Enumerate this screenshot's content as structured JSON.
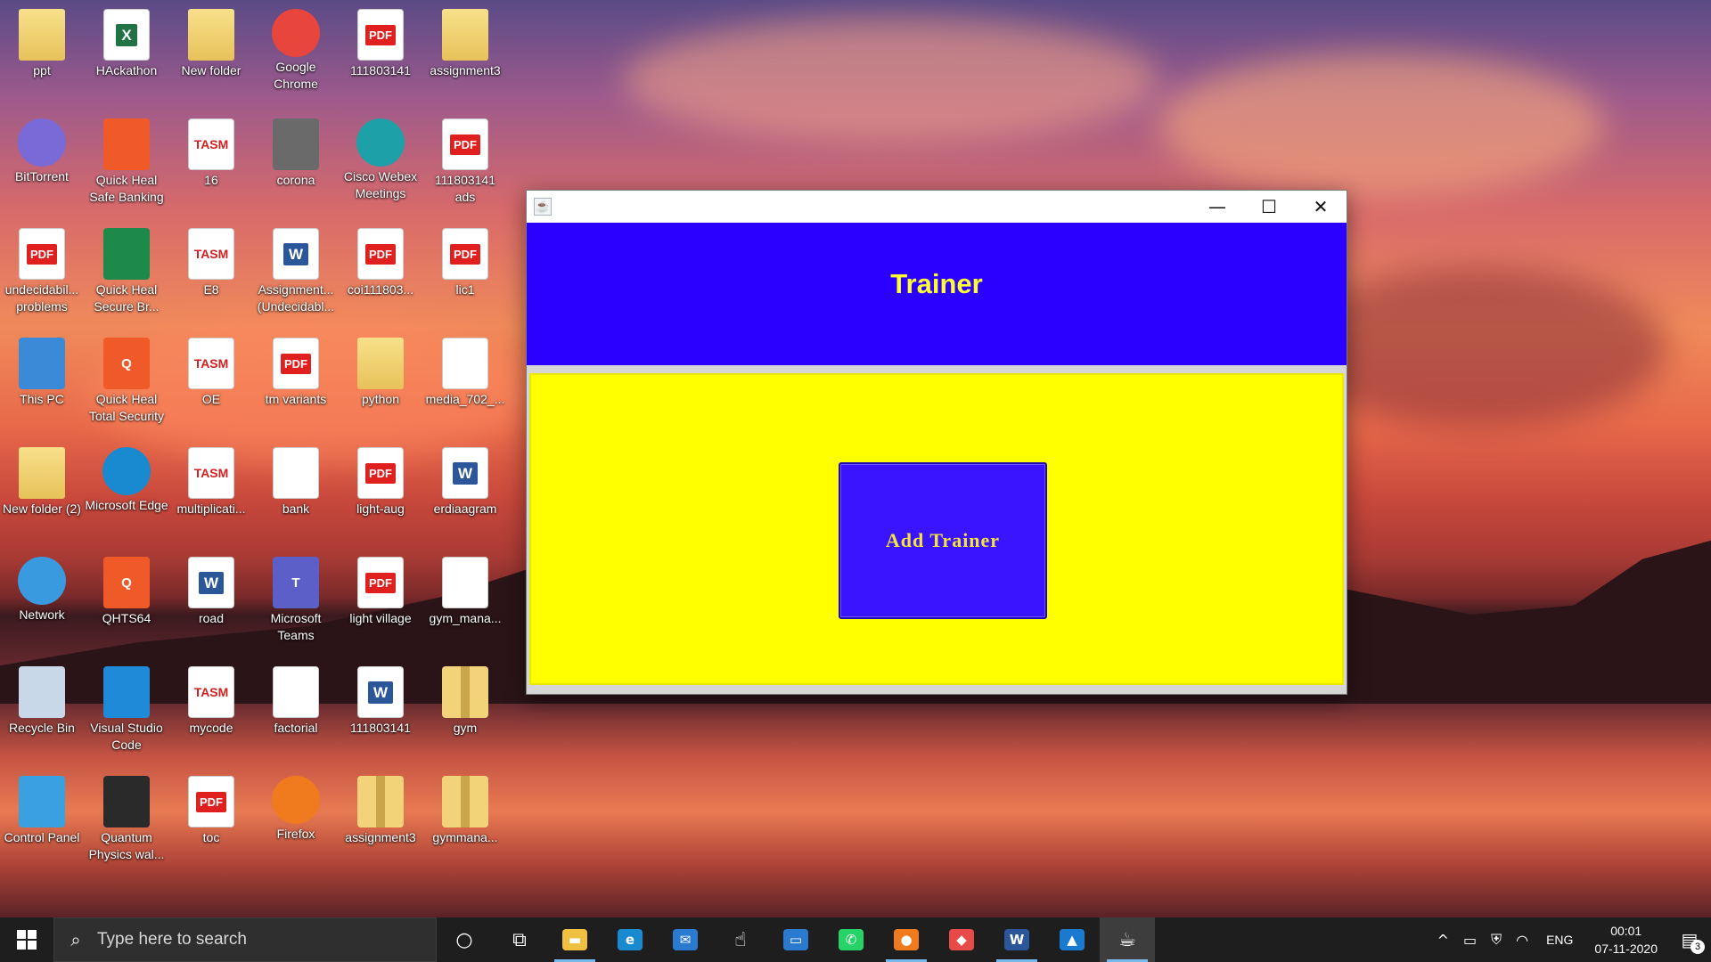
{
  "desktop": {
    "icons": [
      {
        "label": "ppt",
        "kind": "folder"
      },
      {
        "label": "HAckathon",
        "kind": "excel",
        "glyph": "X"
      },
      {
        "label": "New folder",
        "kind": "folder"
      },
      {
        "label": "Google Chrome",
        "kind": "round",
        "color": "#e8453c"
      },
      {
        "label": "111803141",
        "kind": "pdf",
        "glyph": "PDF"
      },
      {
        "label": "assignment3",
        "kind": "folder"
      },
      {
        "label": "BitTorrent",
        "kind": "round",
        "color": "#7a6ad8"
      },
      {
        "label": "Quick Heal Safe Banking",
        "kind": "app",
        "color": "#f05a28"
      },
      {
        "label": "16",
        "kind": "asm",
        "glyph": "TASM"
      },
      {
        "label": "corona",
        "kind": "app",
        "color": "#6a6a6a"
      },
      {
        "label": "Cisco Webex Meetings",
        "kind": "round",
        "color": "#1ea0a8"
      },
      {
        "label": "111803141 ads",
        "kind": "pdf",
        "glyph": "PDF"
      },
      {
        "label": "undecidabil... problems",
        "kind": "pdf",
        "glyph": "PDF"
      },
      {
        "label": "Quick Heal Secure Br...",
        "kind": "app",
        "color": "#1e8a4a"
      },
      {
        "label": "E8",
        "kind": "asm",
        "glyph": "TASM"
      },
      {
        "label": "Assignment... (Undecidabl...",
        "kind": "word",
        "glyph": "W"
      },
      {
        "label": "coi111803...",
        "kind": "pdf",
        "glyph": "PDF"
      },
      {
        "label": "lic1",
        "kind": "pdf",
        "glyph": "PDF"
      },
      {
        "label": "This PC",
        "kind": "app",
        "color": "#3a8ad8"
      },
      {
        "label": "Quick Heal Total Security",
        "kind": "app",
        "color": "#f05a28",
        "glyph": "Q"
      },
      {
        "label": "OE",
        "kind": "asm",
        "glyph": "TASM"
      },
      {
        "label": "tm variants",
        "kind": "pdf",
        "glyph": "PDF"
      },
      {
        "label": "python",
        "kind": "folder"
      },
      {
        "label": "media_702_...",
        "kind": "doc"
      },
      {
        "label": "New folder (2)",
        "kind": "folder"
      },
      {
        "label": "Microsoft Edge",
        "kind": "round",
        "color": "#1a8ad0"
      },
      {
        "label": "multiplicati...",
        "kind": "asm",
        "glyph": "TASM"
      },
      {
        "label": "bank",
        "kind": "doc"
      },
      {
        "label": "light-aug",
        "kind": "pdf",
        "glyph": "PDF"
      },
      {
        "label": "erdiaagram",
        "kind": "word",
        "glyph": "W"
      },
      {
        "label": "Network",
        "kind": "round",
        "color": "#3a9ae0"
      },
      {
        "label": "QHTS64",
        "kind": "app",
        "color": "#f05a28",
        "glyph": "Q"
      },
      {
        "label": "road",
        "kind": "word",
        "glyph": "W"
      },
      {
        "label": "Microsoft Teams",
        "kind": "app",
        "color": "#5b5fc7",
        "glyph": "T"
      },
      {
        "label": "light village",
        "kind": "pdf",
        "glyph": "PDF"
      },
      {
        "label": "gym_mana...",
        "kind": "doc"
      },
      {
        "label": "Recycle Bin",
        "kind": "app",
        "color": "#c8d8e8"
      },
      {
        "label": "Visual Studio Code",
        "kind": "app",
        "color": "#1e8ad8"
      },
      {
        "label": "mycode",
        "kind": "asm",
        "glyph": "TASM"
      },
      {
        "label": "factorial",
        "kind": "doc"
      },
      {
        "label": "111803141",
        "kind": "word",
        "glyph": "W"
      },
      {
        "label": "gym",
        "kind": "zip"
      },
      {
        "label": "Control Panel",
        "kind": "app",
        "color": "#3aa0e0"
      },
      {
        "label": "Quantum Physics wal...",
        "kind": "app",
        "color": "#2a2a2a"
      },
      {
        "label": "toc",
        "kind": "pdf",
        "glyph": "PDF"
      },
      {
        "label": "Firefox",
        "kind": "round",
        "color": "#f07a1e"
      },
      {
        "label": "assignment3",
        "kind": "zip"
      },
      {
        "label": "gymmana...",
        "kind": "zip"
      }
    ]
  },
  "window": {
    "app_icon": "java-icon",
    "minimize_glyph": "—",
    "maximize_glyph": "☐",
    "close_glyph": "✕",
    "header_title": "Trainer",
    "add_button_label": "Add Trainer",
    "colors": {
      "header": "#2b00ff",
      "content": "#ffff00",
      "button": "#3a14ff",
      "text": "#ffff30"
    }
  },
  "taskbar": {
    "search_placeholder": "Type here to search",
    "apps": [
      {
        "name": "cortana-icon",
        "glyph": "○",
        "color": ""
      },
      {
        "name": "task-view-icon",
        "glyph": "⧉",
        "color": ""
      },
      {
        "name": "file-explorer-icon",
        "glyph": "▬",
        "color": "#f0c040",
        "active": true
      },
      {
        "name": "edge-icon",
        "glyph": "e",
        "color": "#1a8ad0"
      },
      {
        "name": "mail-icon",
        "glyph": "✉",
        "color": "#2a7ad0"
      },
      {
        "name": "touch-icon",
        "glyph": "☝",
        "color": ""
      },
      {
        "name": "window-app-icon",
        "glyph": "▭",
        "color": "#2a7ad0"
      },
      {
        "name": "whatsapp-icon",
        "glyph": "✆",
        "color": "#25d366"
      },
      {
        "name": "firefox-icon",
        "glyph": "●",
        "color": "#f07a1e",
        "active": true
      },
      {
        "name": "cube-app-icon",
        "glyph": "◆",
        "color": "#e84a4a"
      },
      {
        "name": "word-icon",
        "glyph": "W",
        "color": "#2b579a",
        "active": true
      },
      {
        "name": "photos-icon",
        "glyph": "▲",
        "color": "#1a7ad0"
      },
      {
        "name": "java-icon",
        "glyph": "☕",
        "color": "",
        "active": true,
        "selected": true
      }
    ],
    "tray": {
      "chevron": "^",
      "battery": "▭",
      "security": "⛨",
      "wifi": "◠",
      "language": "ENG",
      "time": "00:01",
      "date": "07-11-2020",
      "notifications_count": "3"
    }
  }
}
